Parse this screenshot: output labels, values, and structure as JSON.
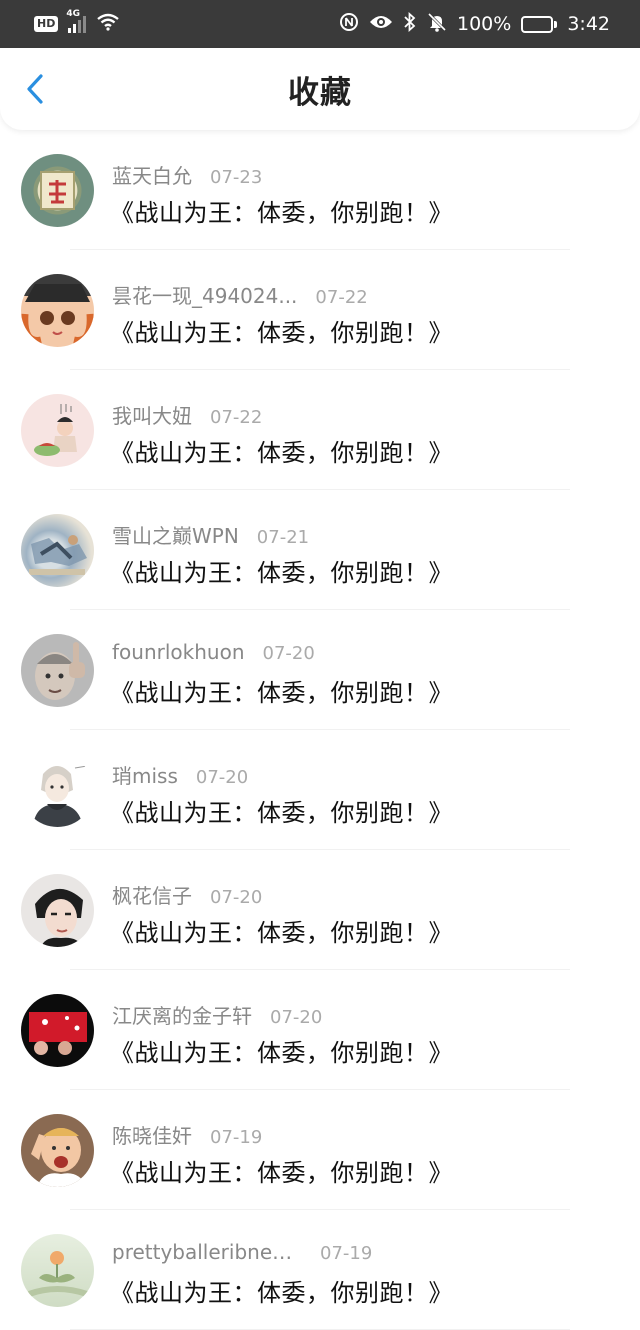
{
  "status_bar": {
    "network_badge": "HD",
    "network_type": "4G",
    "battery_text": "100%",
    "time": "3:42"
  },
  "header": {
    "title": "收藏",
    "accent_color": "#2a8fe0"
  },
  "favorites": [
    {
      "user": "蓝天白允",
      "date": "07-23",
      "title": "《战山为王：体委，你别跑！》"
    },
    {
      "user": "昙花一现_494024...",
      "date": "07-22",
      "title": "《战山为王：体委，你别跑！》"
    },
    {
      "user": "我叫大妞",
      "date": "07-22",
      "title": "《战山为王：体委，你别跑！》"
    },
    {
      "user": "雪山之巅WPN",
      "date": "07-21",
      "title": "《战山为王：体委，你别跑！》"
    },
    {
      "user": "founrlokhuon",
      "date": "07-20",
      "title": "《战山为王：体委，你别跑！》"
    },
    {
      "user": "琑miss",
      "date": "07-20",
      "title": "《战山为王：体委，你别跑！》"
    },
    {
      "user": "枫花信子",
      "date": "07-20",
      "title": "《战山为王：体委，你别跑！》"
    },
    {
      "user": "江厌离的金子轩",
      "date": "07-20",
      "title": "《战山为王：体委，你别跑！》"
    },
    {
      "user": "陈晓佳奸",
      "date": "07-19",
      "title": "《战山为王：体委，你别跑！》"
    },
    {
      "user": "prettyballeribneams",
      "date": "07-19",
      "title": "《战山为王：体委，你别跑！》"
    }
  ]
}
